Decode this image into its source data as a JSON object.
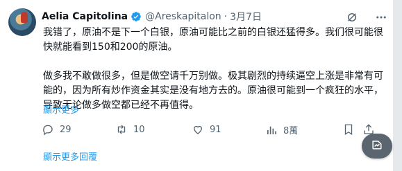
{
  "tweet": {
    "author_name": "Aelia Capitolina",
    "handle": "@Areskapitalon",
    "separator": "·",
    "date": "3月7日",
    "paragraphs": [
      "我错了，原油不是下一个白银，原油可能比之前的白银还猛得多。我们很可能很快就能看到150和200的原油。",
      "做多我不敢做很多，但是做空请千万别做。极其剧烈的持续逼空上涨是非常有可能的，因为所有炒作资金其实是没有地方去的。原油很可能到一个疯狂的水平，导致无论做多做空都已经不再值得。"
    ],
    "show_more": "顯示更多"
  },
  "actions": {
    "replies": "29",
    "retweets": "10",
    "likes": "91",
    "views": "8萬"
  },
  "footer": {
    "show_more_replies": "顯示更多回覆"
  },
  "colors": {
    "accent": "#1d9bf0",
    "muted": "#536471",
    "text": "#0f1419",
    "verified": "#1d9bf0"
  },
  "icons": [
    "verified-badge-icon",
    "grok-icon",
    "more-icon",
    "reply-icon",
    "retweet-icon",
    "like-icon",
    "views-icon",
    "bookmark-icon",
    "share-icon",
    "fab-icon"
  ]
}
